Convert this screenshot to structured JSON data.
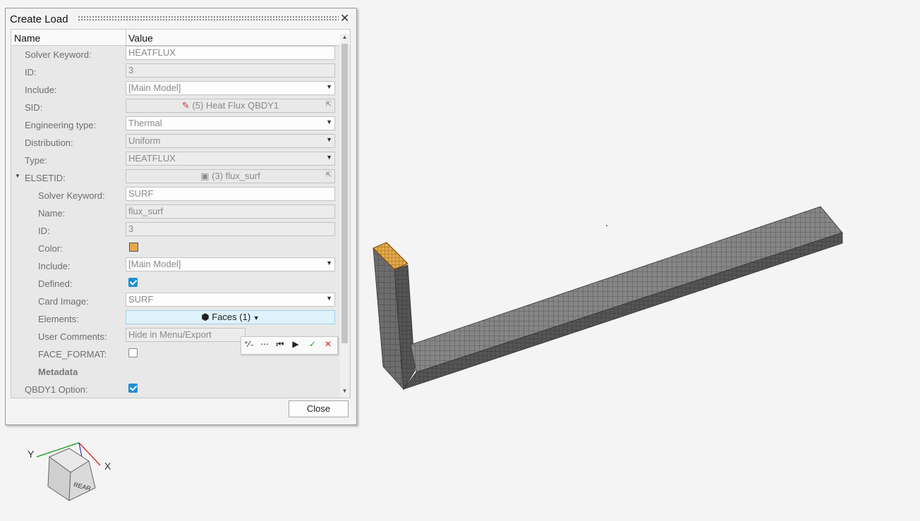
{
  "dialog": {
    "title": "Create Load",
    "close_label": "Close",
    "columns": {
      "name": "Name",
      "value": "Value"
    },
    "rows": {
      "solver_keyword": {
        "label": "Solver Keyword:",
        "value": "HEATFLUX"
      },
      "id": {
        "label": "ID:",
        "value": "3"
      },
      "include": {
        "label": "Include:",
        "value": "[Main Model]"
      },
      "sid": {
        "label": "SID:",
        "value": "(5)  Heat Flux QBDY1"
      },
      "engineering_type": {
        "label": "Engineering type:",
        "value": "Thermal"
      },
      "distribution": {
        "label": "Distribution:",
        "value": "Uniform"
      },
      "type": {
        "label": "Type:",
        "value": "HEATFLUX"
      },
      "elsetid": {
        "label": "ELSETID:",
        "value": "(3) flux_surf"
      },
      "sub_solver_keyword": {
        "label": "Solver Keyword:",
        "value": "SURF"
      },
      "sub_name": {
        "label": "Name:",
        "value": "flux_surf"
      },
      "sub_id": {
        "label": "ID:",
        "value": "3"
      },
      "sub_color": {
        "label": "Color:",
        "value": "#e5a84b"
      },
      "sub_include": {
        "label": "Include:",
        "value": "[Main Model]"
      },
      "sub_defined": {
        "label": "Defined:",
        "checked": true
      },
      "sub_card_image": {
        "label": "Card Image:",
        "value": "SURF"
      },
      "sub_elements": {
        "label": "Elements:",
        "value": "Faces (1)"
      },
      "sub_user_comments": {
        "label": "User Comments:",
        "value": "Hide in Menu/Export"
      },
      "sub_face_format": {
        "label": "FACE_FORMAT:",
        "checked": false
      },
      "metadata": {
        "label": "Metadata"
      },
      "qbdy1_option": {
        "label": "QBDY1 Option:",
        "checked": true
      }
    }
  },
  "view_cube": {
    "axis_y": "Y",
    "axis_x": "X",
    "face_front": "REAR"
  },
  "colors": {
    "selection": "#e5a84b",
    "accent": "#1d8fd6"
  }
}
